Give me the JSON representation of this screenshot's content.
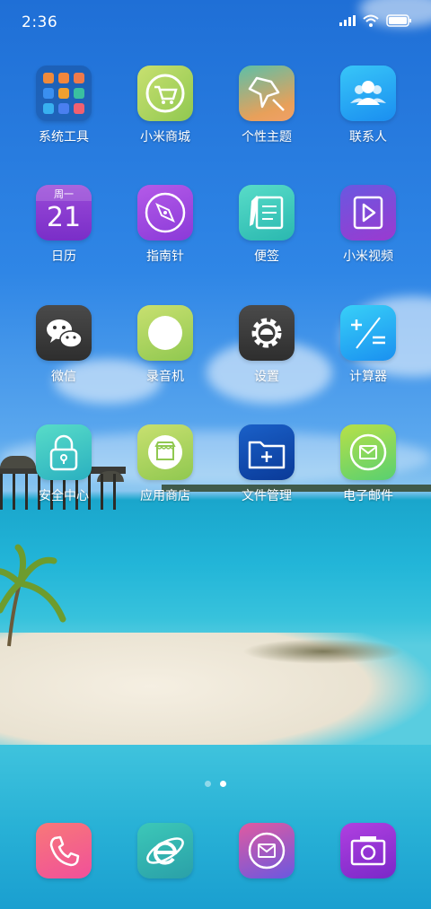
{
  "status_bar": {
    "time": "2:36",
    "signal_icon": "signal-bars-icon",
    "wifi_icon": "wifi-icon",
    "battery_icon": "battery-icon"
  },
  "apps": [
    {
      "label": "系统工具",
      "icon": "folder-icon"
    },
    {
      "label": "小米商城",
      "icon": "shopping-cart-icon"
    },
    {
      "label": "个性主题",
      "icon": "theme-star-icon"
    },
    {
      "label": "联系人",
      "icon": "contacts-icon"
    },
    {
      "label": "日历",
      "icon": "calendar-icon",
      "weekday": "周一",
      "day": "21"
    },
    {
      "label": "指南针",
      "icon": "compass-icon"
    },
    {
      "label": "便签",
      "icon": "notes-icon"
    },
    {
      "label": "小米视频",
      "icon": "video-play-icon"
    },
    {
      "label": "微信",
      "icon": "wechat-icon"
    },
    {
      "label": "录音机",
      "icon": "recorder-icon"
    },
    {
      "label": "设置",
      "icon": "gear-icon"
    },
    {
      "label": "计算器",
      "icon": "calculator-icon"
    },
    {
      "label": "安全中心",
      "icon": "lock-icon"
    },
    {
      "label": "应用商店",
      "icon": "app-store-icon"
    },
    {
      "label": "文件管理",
      "icon": "file-folder-icon"
    },
    {
      "label": "电子邮件",
      "icon": "mail-icon"
    }
  ],
  "page_indicator": {
    "count": 2,
    "active": 2
  },
  "dock": [
    {
      "name": "phone",
      "icon": "phone-icon"
    },
    {
      "name": "browser",
      "icon": "browser-e-icon"
    },
    {
      "name": "messages",
      "icon": "message-icon"
    },
    {
      "name": "camera",
      "icon": "camera-icon"
    }
  ]
}
